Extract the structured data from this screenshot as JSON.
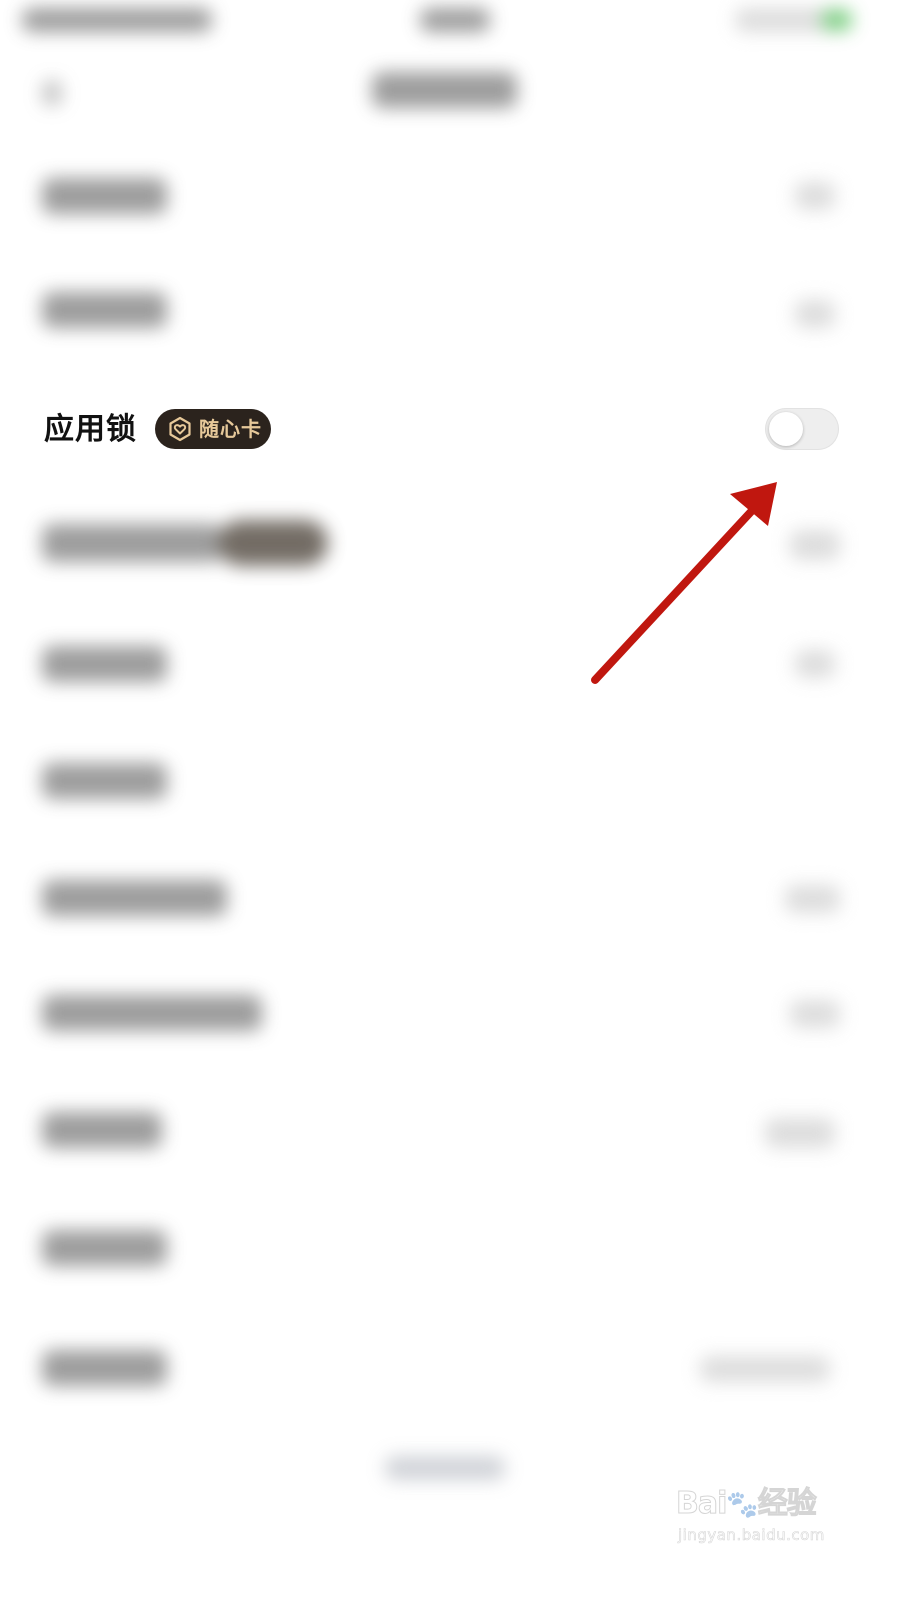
{
  "setting_row": {
    "label": "应用锁",
    "badge_text": "随心卡",
    "badge_icon": "heart-hexagon-icon",
    "toggle_state": "off"
  },
  "annotation": {
    "type": "arrow",
    "color": "#c0170f",
    "points_to": "toggle-switch"
  },
  "watermark": {
    "brand": "Bai经验",
    "url": "jingyan.baidu.com"
  },
  "colors": {
    "badge_bg": "#2b231d",
    "badge_text": "#e7c99a",
    "toggle_track_off": "#eeeeee",
    "arrow": "#c0170f"
  }
}
